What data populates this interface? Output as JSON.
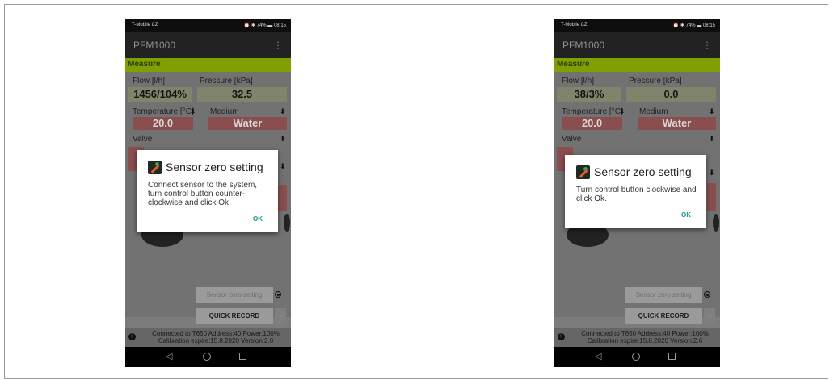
{
  "phones": [
    {
      "status": {
        "carrier": "T-Mobile CZ",
        "right": "⏰ ✱ 74% ▬ 08:15"
      },
      "app_title": "PFM1000",
      "measure_label": "Measure",
      "flow_label": "Flow [l/h]",
      "flow_value": "1456/104%",
      "pressure_label": "Pressure [kPa]",
      "pressure_value": "32.5",
      "temperature_label": "Temperature [°C]",
      "temperature_value": "20.0",
      "medium_label": "Medium",
      "medium_value": "Water",
      "valve_label": "Valve",
      "dialog": {
        "title": "Sensor zero setting",
        "message": "Connect sensor to the system, turn control button counter-clockwise and click Ok.",
        "ok_label": "OK"
      },
      "sensor_zero_button": "Sensor zero setting",
      "quick_record_button": "QUICK RECORD",
      "connection_line1": "Connected to T650 Address:40 Power:100%",
      "connection_line2": "Calibration expire:15.8.2020 Version:2.6"
    },
    {
      "status": {
        "carrier": "T-Mobile CZ",
        "right": "⏰ ✱ 74% ▬ 08:15"
      },
      "app_title": "PFM1000",
      "measure_label": "Measure",
      "flow_label": "Flow [l/h]",
      "flow_value": "38/3%",
      "pressure_label": "Pressure [kPa]",
      "pressure_value": "0.0",
      "temperature_label": "Temperature [°C]",
      "temperature_value": "20.0",
      "medium_label": "Medium",
      "medium_value": "Water",
      "valve_label": "Valve",
      "dialog": {
        "title": "Sensor zero setting",
        "message": "Turn control button clockwise and click Ok.",
        "ok_label": "OK"
      },
      "sensor_zero_button": "Sensor zero setting",
      "quick_record_button": "QUICK RECORD",
      "connection_line1": "Connected to T650 Address:40 Power:100%",
      "connection_line2": "Calibration expire:15.8.2020 Version:2.6"
    }
  ],
  "colors": {
    "measure_bar": "#7fa000",
    "flow_box": "#7f856b",
    "red_box": "#8a4e4e",
    "ok_button": "#159b8c",
    "app_bar": "#222222"
  },
  "icons": {
    "menu": "overflow-menu-icon",
    "download": "download-icon",
    "dialog": "sensor-gauge-icon",
    "connection": "bluetooth-icon",
    "radio": "radio-selected-icon",
    "nav_back": "back-triangle-icon",
    "nav_home": "home-circle-icon",
    "nav_recent": "recent-square-icon"
  }
}
